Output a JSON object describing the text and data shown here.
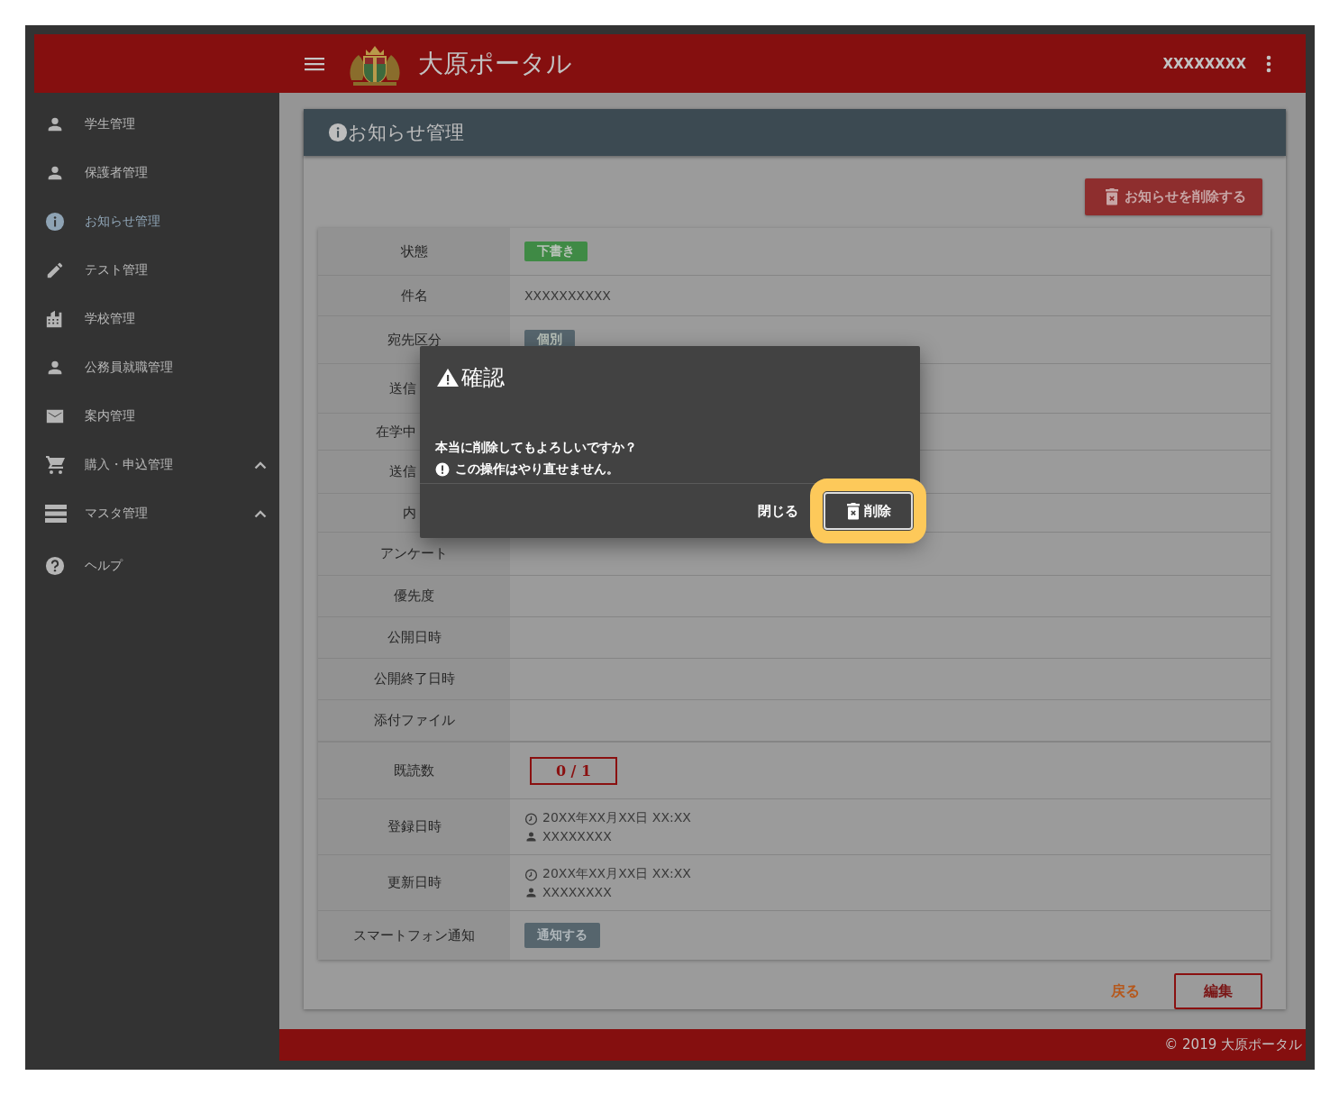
{
  "header": {
    "title": "大原ポータル",
    "user": "XXXXXXXX"
  },
  "sidebar": {
    "items": [
      {
        "label": "学生管理",
        "kind": "link",
        "selected": false
      },
      {
        "label": "保護者管理",
        "kind": "link",
        "selected": false
      },
      {
        "label": "お知らせ管理",
        "kind": "link",
        "selected": true
      },
      {
        "label": "テスト管理",
        "kind": "link",
        "selected": false
      },
      {
        "label": "学校管理",
        "kind": "link",
        "selected": false
      },
      {
        "label": "公務員就職管理",
        "kind": "link",
        "selected": false
      },
      {
        "label": "案内管理",
        "kind": "link",
        "selected": false
      },
      {
        "label": "購入・申込管理",
        "kind": "group",
        "selected": false
      },
      {
        "label": "マスタ管理",
        "kind": "group",
        "selected": false
      },
      {
        "label": "ヘルプ",
        "kind": "link",
        "selected": false
      }
    ]
  },
  "page": {
    "title": "お知らせ管理",
    "delete_button": "お知らせを削除する",
    "rows": [
      {
        "label": "状態",
        "kind": "badge",
        "value": "下書き",
        "color": "#3f8a45"
      },
      {
        "label": "件名",
        "kind": "text",
        "value": "XXXXXXXXXX"
      },
      {
        "label": "宛先区分",
        "kind": "badge",
        "value": "個別",
        "color": "#56656d"
      },
      {
        "label": "送信",
        "kind": "covered"
      },
      {
        "label": "在学中",
        "kind": "covered"
      },
      {
        "label": "送信",
        "kind": "covered"
      },
      {
        "label": "内",
        "kind": "covered"
      },
      {
        "label": "アンケート",
        "kind": "empty"
      },
      {
        "label": "優先度",
        "kind": "empty"
      },
      {
        "label": "公開日時",
        "kind": "empty"
      },
      {
        "label": "公開終了日時",
        "kind": "empty"
      },
      {
        "label": "添付ファイル",
        "kind": "empty"
      },
      {
        "label": "既読数",
        "kind": "count",
        "value": "0 / 1"
      },
      {
        "label": "登録日時",
        "kind": "audit",
        "date": "20XX年XX月XX日 XX:XX",
        "user": "XXXXXXXX"
      },
      {
        "label": "更新日時",
        "kind": "audit",
        "date": "20XX年XX月XX日 XX:XX",
        "user": "XXXXXXXX"
      },
      {
        "label": "スマートフォン通知",
        "kind": "button",
        "value": "通知する",
        "color": "#56656d"
      }
    ],
    "back": "戻る",
    "edit": "編集"
  },
  "dialog": {
    "title": "確認",
    "message": "本当に削除してもよろしいですか？",
    "warning": "この操作はやり直せません。",
    "close": "閉じる",
    "confirm": "削除",
    "confirm_focused": true
  },
  "footer": "© 2019 大原ポータル"
}
